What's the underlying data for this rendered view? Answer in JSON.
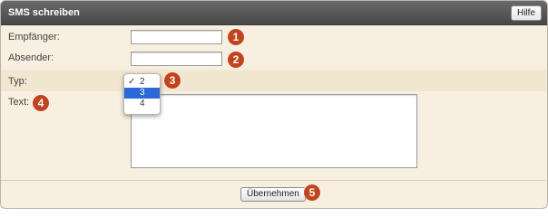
{
  "header": {
    "title": "SMS schreiben",
    "help_label": "Hilfe"
  },
  "form": {
    "recipient_label": "Empfänger:",
    "recipient_value": "",
    "sender_label": "Absender:",
    "sender_value": "",
    "type_label": "Typ:",
    "type_options": [
      {
        "label": "2",
        "checked": "✓"
      },
      {
        "label": "3",
        "checked": ""
      },
      {
        "label": "4",
        "checked": ""
      }
    ],
    "type_highlighted": "3",
    "text_label": "Text:",
    "text_value": ""
  },
  "footer": {
    "submit_label": "Übernehmen"
  },
  "badges": [
    "1",
    "2",
    "3",
    "4",
    "5"
  ],
  "colors": {
    "badge": "#c3441c",
    "titlebar": "#4f4f4f",
    "panel_bg": "#f7efe0",
    "selection": "#2a6ad8"
  }
}
